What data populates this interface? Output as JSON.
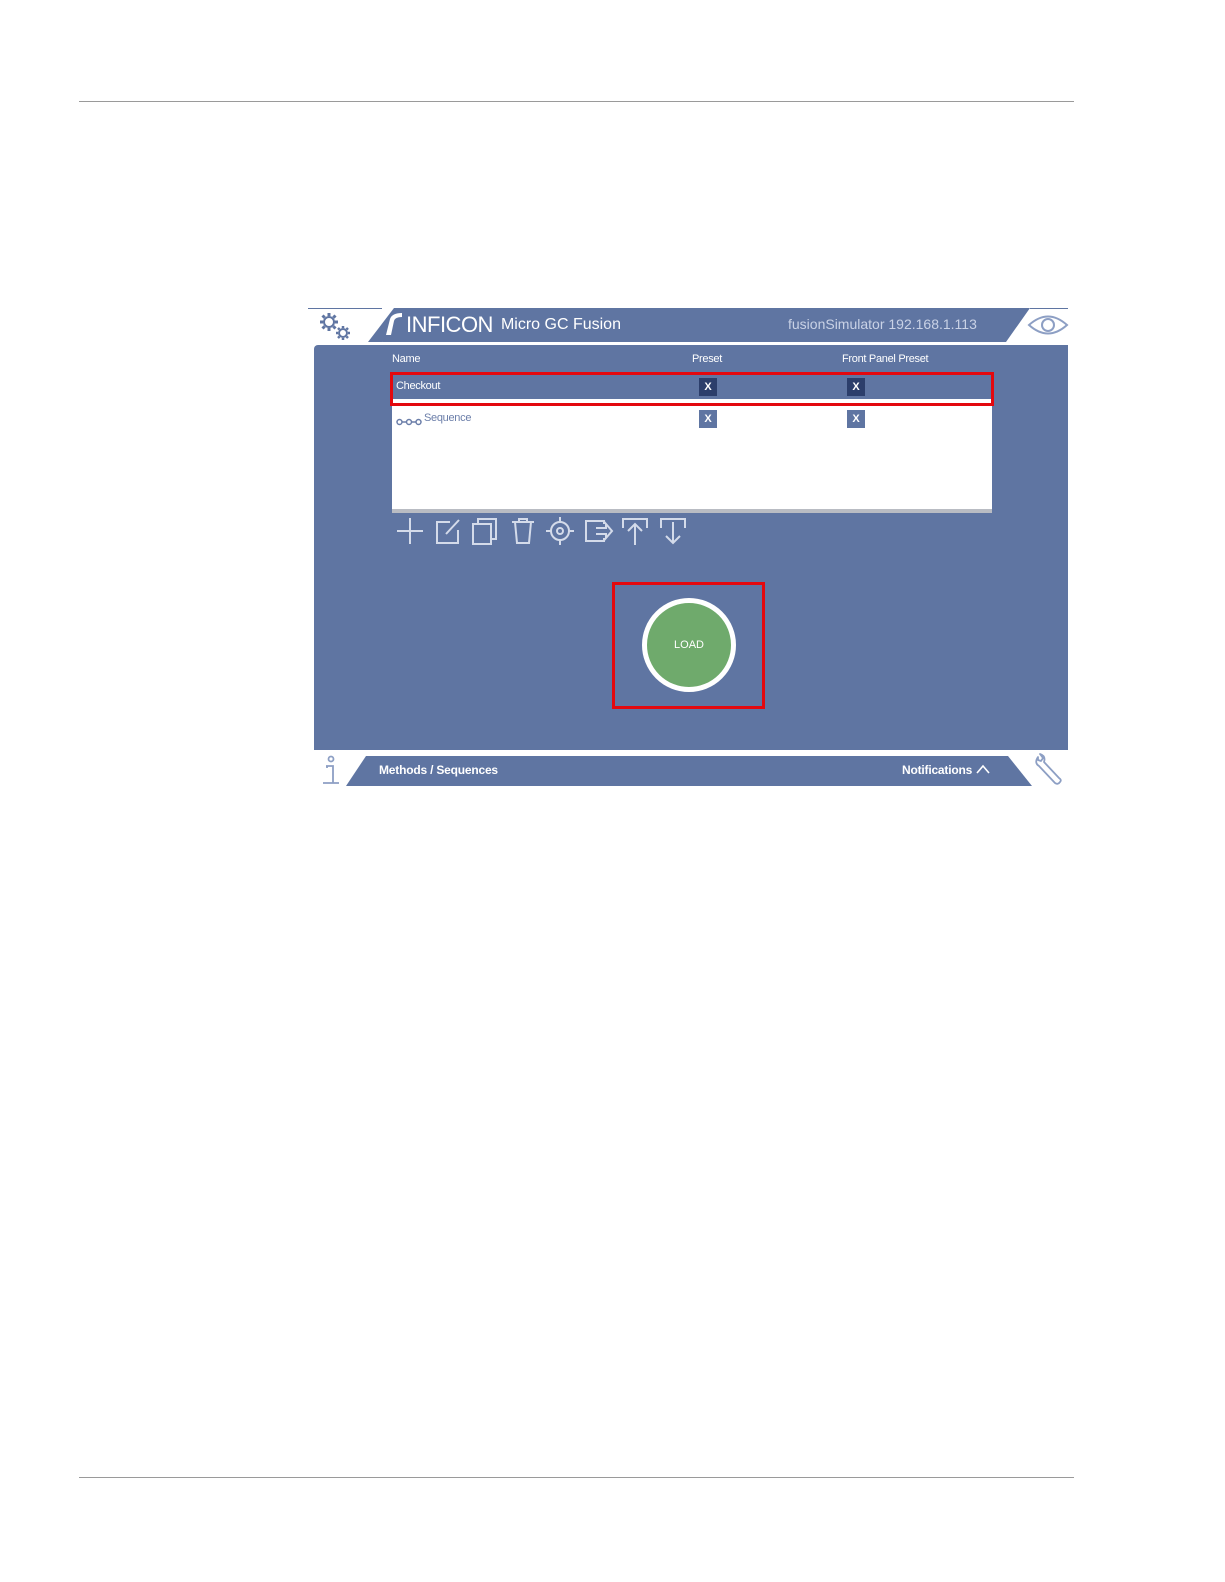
{
  "header": {
    "brand": "INFICON",
    "product": "Micro GC Fusion",
    "host": "fusionSimulator 192.168.1.113"
  },
  "table": {
    "columns": [
      "Name",
      "Preset",
      "Front Panel Preset"
    ],
    "rows": [
      {
        "name": "Checkout",
        "preset": "X",
        "front_panel_preset": "X"
      },
      {
        "name": "Sequence",
        "preset": "X",
        "front_panel_preset": "X"
      }
    ]
  },
  "toolbar": [
    "add-icon",
    "edit-icon",
    "copy-icon",
    "delete-icon",
    "target-icon",
    "export-icon",
    "upload-icon",
    "download-icon"
  ],
  "load_button": "LOAD",
  "footer": {
    "left": "Methods / Sequences",
    "right": "Notifications"
  },
  "colors": {
    "panel": "#5f75a2",
    "selected_check": "#2c3e6b",
    "load": "#6faa6c",
    "highlight": "#e3080e"
  }
}
